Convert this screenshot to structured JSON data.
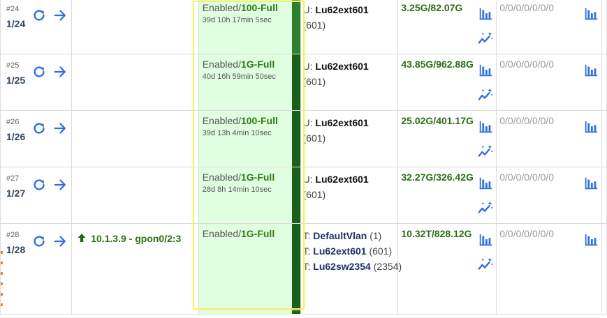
{
  "rows": [
    {
      "num": "#24",
      "name": "1/24",
      "desc": "",
      "status": "Enabled/",
      "speed": "100-Full",
      "uptime": "39d 10h 17min 5sec",
      "vlan": [
        {
          "mode": "U: ",
          "name": "Lu62ext601",
          "id": "(601)"
        }
      ],
      "traffic": "3.25G/82.07G",
      "errors": "0/0/0/0/0/0/0"
    },
    {
      "num": "#25",
      "name": "1/25",
      "desc": "",
      "status": "Enabled/",
      "speed": "1G-Full",
      "uptime": "40d 16h 59min 50sec",
      "vlan": [
        {
          "mode": "U: ",
          "name": "Lu62ext601",
          "id": "(601)"
        }
      ],
      "traffic": "43.85G/962.88G",
      "errors": "0/0/0/0/0/0/0"
    },
    {
      "num": "#26",
      "name": "1/26",
      "desc": "",
      "status": "Enabled/",
      "speed": "100-Full",
      "uptime": "39d 13h 4min 10sec",
      "vlan": [
        {
          "mode": "U: ",
          "name": "Lu62ext601",
          "id": "(601)"
        }
      ],
      "traffic": "25.02G/401.17G",
      "errors": "0/0/0/0/0/0/0"
    },
    {
      "num": "#27",
      "name": "1/27",
      "desc": "",
      "status": "Enabled/",
      "speed": "1G-Full",
      "uptime": "28d 8h 14min 10sec",
      "vlan": [
        {
          "mode": "U: ",
          "name": "Lu62ext601",
          "id": "(601)"
        }
      ],
      "traffic": "32.27G/326.42G",
      "errors": "0/0/0/0/0/0/0"
    },
    {
      "num": "#28",
      "name": "1/28",
      "desc": "10.1.3.9 - gpon0/2:3",
      "status": "Enabled/",
      "speed": "1G-Full",
      "uptime": "",
      "vlan": [
        {
          "mode": "T: ",
          "name": "DefaultVlan",
          "id": "(1)"
        },
        {
          "mode": "T: ",
          "name": "Lu62ext601",
          "id": "(601)"
        },
        {
          "mode": "T: ",
          "name": "Lu62sw2354",
          "id": "(2354)"
        }
      ],
      "traffic": "10.32T/828.12G",
      "errors": "0/0/0/0/0/0/0"
    }
  ],
  "icons": {
    "refresh": "refresh-icon",
    "go": "arrow-right-icon",
    "graph": "bar-chart-icon",
    "spark": "sparkle-trend-icon",
    "uplink": "arrow-up-icon"
  },
  "colors": {
    "accent": "#2f6fe0",
    "status_green": "#2e7d12",
    "status_bg": "#e0fee0",
    "highlight": "#f1f268"
  }
}
